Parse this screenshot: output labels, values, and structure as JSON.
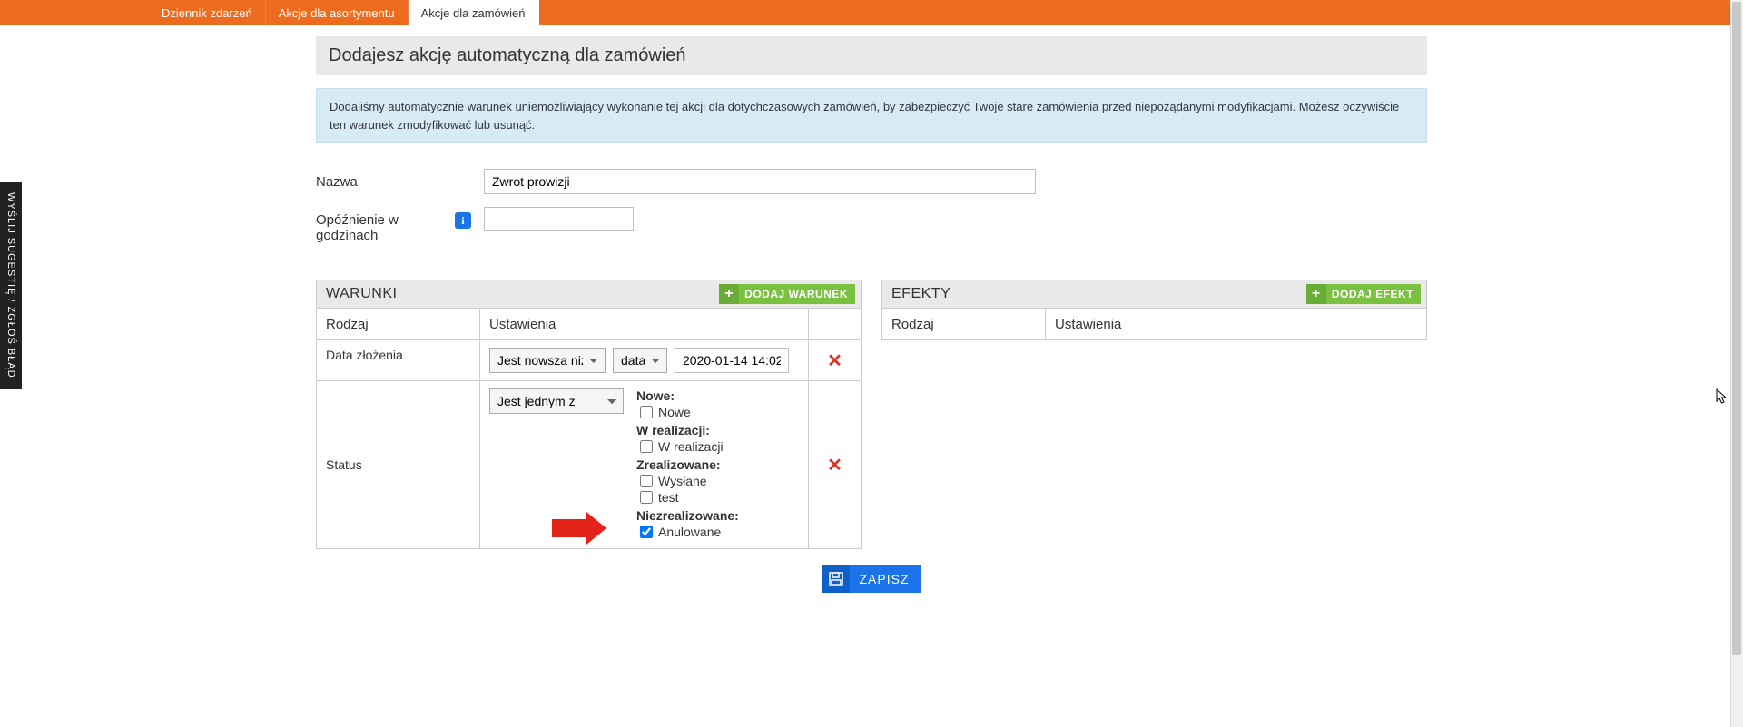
{
  "tabs": {
    "t0": "Dziennik zdarzeń",
    "t1": "Akcje dla asortymentu",
    "t2": "Akcje dla zamówień"
  },
  "page_title": "Dodajesz akcję automatyczną dla zamówień",
  "info_text": "Dodaliśmy automatycznie warunek uniemożliwiający wykonanie tej akcji dla dotychczasowych zamówień, by zabezpieczyć Twoje stare zamówienia przed niepożądanymi modyfikacjami. Możesz oczywiście ten warunek zmodyfikować lub usunąć.",
  "form": {
    "name_label": "Nazwa",
    "name_value": "Zwrot prowizji",
    "delay_label": "Opóźnienie w godzinach",
    "delay_value": ""
  },
  "conditions": {
    "title": "WARUNKI",
    "add_label": "DODAJ WARUNEK",
    "col_type": "Rodzaj",
    "col_settings": "Ustawienia",
    "rows": {
      "r0": {
        "type": "Data złożenia",
        "op": "Jest nowsza niż",
        "mode": "data",
        "value": "2020-01-14 14:02"
      },
      "r1": {
        "type": "Status",
        "op": "Jest jednym z",
        "groups": {
          "g0": {
            "title": "Nowe:",
            "items": [
              {
                "label": "Nowe",
                "checked": false
              }
            ]
          },
          "g1": {
            "title": "W realizacji:",
            "items": [
              {
                "label": "W realizacji",
                "checked": false
              }
            ]
          },
          "g2": {
            "title": "Zrealizowane:",
            "items": [
              {
                "label": "Wysłane",
                "checked": false
              },
              {
                "label": "test",
                "checked": false
              }
            ]
          },
          "g3": {
            "title": "Niezrealizowane:",
            "items": [
              {
                "label": "Anulowane",
                "checked": true
              }
            ]
          }
        }
      }
    }
  },
  "effects": {
    "title": "EFEKTY",
    "add_label": "DODAJ EFEKT",
    "col_type": "Rodzaj",
    "col_settings": "Ustawienia"
  },
  "save_label": "ZAPISZ",
  "side_tab": "WYŚLIJ SUGESTIĘ / ZGŁOŚ BŁĄD"
}
